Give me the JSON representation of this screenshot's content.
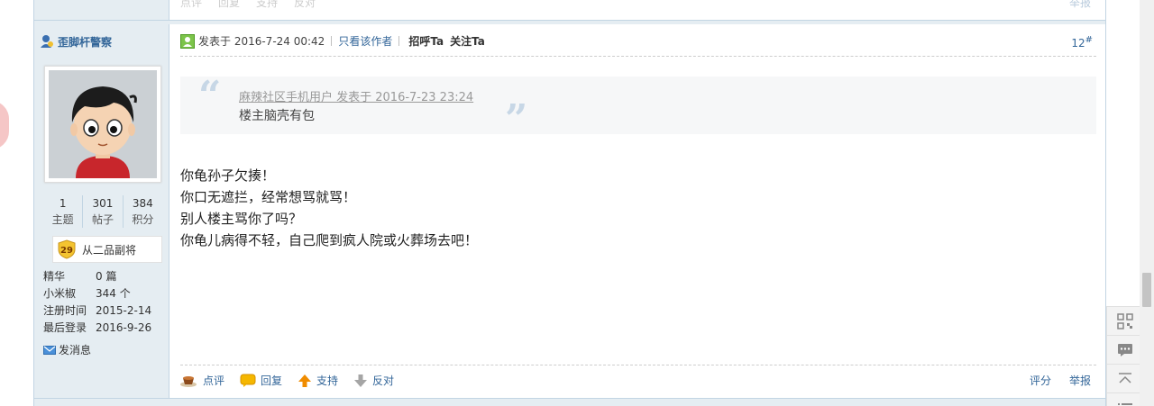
{
  "previous_post": {
    "actions": [
      "点评",
      "回复",
      "支持",
      "反对"
    ],
    "report": "举报"
  },
  "author": {
    "name": "歪脚杆警察",
    "stats": [
      {
        "value": "1",
        "label": "主题"
      },
      {
        "value": "301",
        "label": "帖子"
      },
      {
        "value": "384",
        "label": "积分"
      }
    ],
    "rank_level": "29",
    "rank_title": "从二品副将",
    "info": [
      {
        "key": "精华",
        "value": "0 篇"
      },
      {
        "key": "小米椒",
        "value": "344 个"
      },
      {
        "key": "注册时间",
        "value": "2015-2-14"
      },
      {
        "key": "最后登录",
        "value": "2016-9-26"
      }
    ],
    "send_message": "发消息"
  },
  "post": {
    "posted_at": "发表于 2016-7-24 00:42",
    "only_author": "只看该作者",
    "greet": "招呼Ta",
    "follow": "关注Ta",
    "floor_number": "12",
    "floor_mark": "#",
    "quote": {
      "header": "麻辣社区手机用户 发表于 2016-7-23 23:24",
      "body": "楼主脑壳有包"
    },
    "content": [
      "你龟孙子欠揍！",
      "你口无遮拦，经常想骂就骂！",
      "别人楼主骂你了吗？",
      "你龟儿病得不轻，自己爬到疯人院或火葬场去吧！"
    ],
    "actions": [
      "点评",
      "回复",
      "支持",
      "反对"
    ],
    "rate": "评分",
    "report": "举报"
  },
  "side_tools": [
    "qrcode-icon",
    "comment-icon",
    "back-to-top-icon",
    "list-icon"
  ],
  "colors": {
    "link": "#336699",
    "sidebar_bg": "#e5edf2",
    "border": "#c2d5e3"
  }
}
